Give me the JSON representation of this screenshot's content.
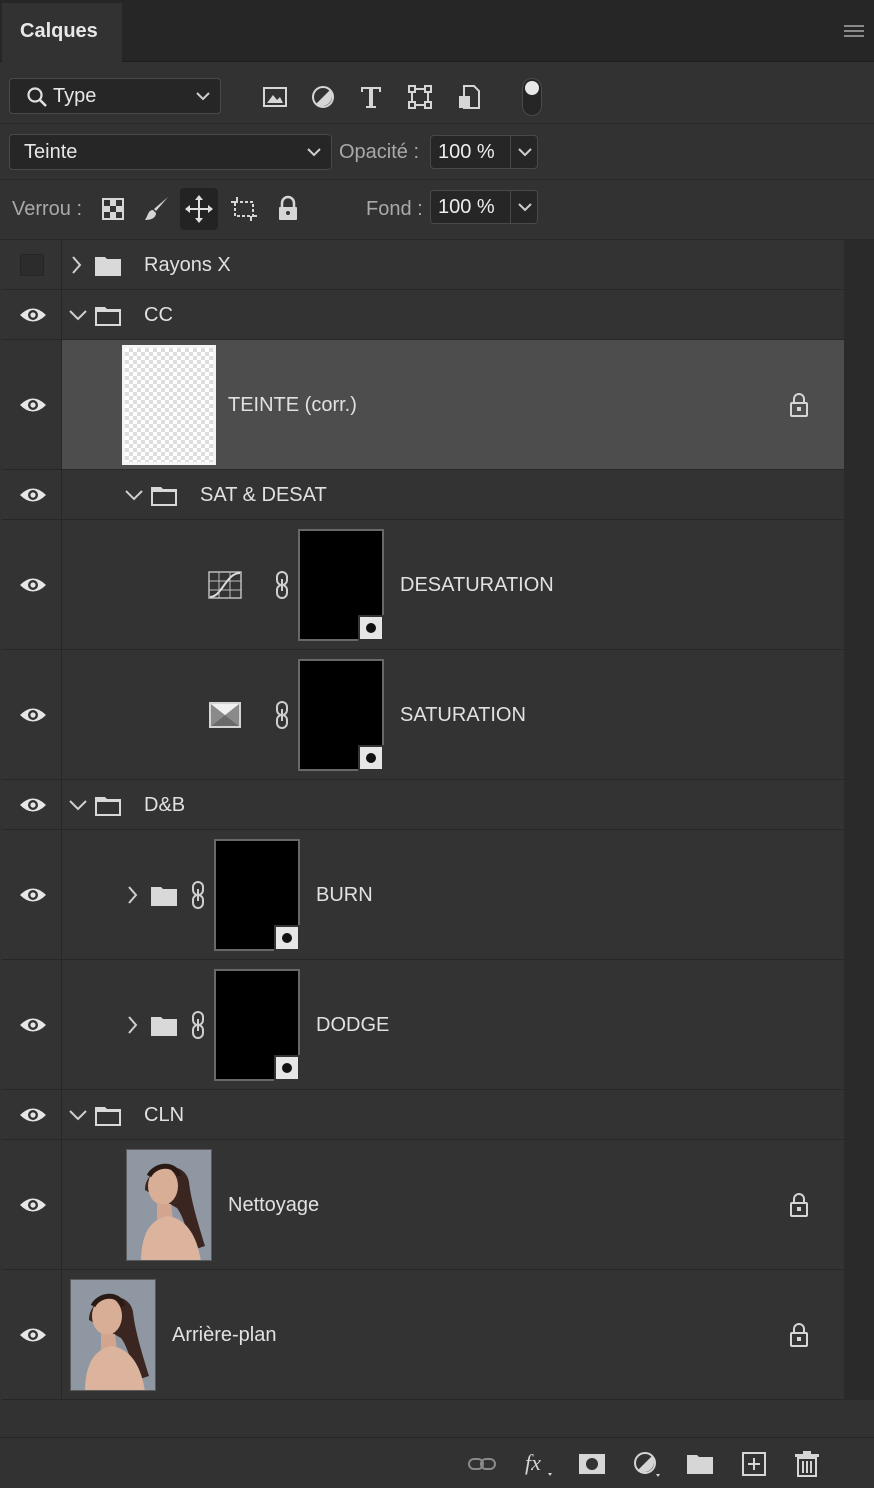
{
  "panel": {
    "title": "Calques"
  },
  "filter": {
    "selected": "Type",
    "icons": [
      "image-filter-icon",
      "adjustment-filter-icon",
      "type-filter-icon",
      "shape-filter-icon",
      "smart-object-filter-icon"
    ]
  },
  "blend": {
    "mode": "Teinte",
    "opacity_label": "Opacité :",
    "opacity_value": "100 %"
  },
  "lock": {
    "label": "Verrou :",
    "fill_label": "Fond :",
    "fill_value": "100 %"
  },
  "layers": [
    {
      "name": "Rayons X",
      "type": "group",
      "visible": false,
      "expanded": false
    },
    {
      "name": "CC",
      "type": "group",
      "visible": true,
      "expanded": true
    },
    {
      "name": "TEINTE (corr.)",
      "type": "pixel",
      "visible": true,
      "selected": true,
      "locked": true
    },
    {
      "name": "SAT & DESAT",
      "type": "group",
      "visible": true,
      "expanded": true
    },
    {
      "name": "DESATURATION",
      "type": "adjustment",
      "adjustment_icon": "curves-icon",
      "visible": true,
      "has_mask": true
    },
    {
      "name": "SATURATION",
      "type": "adjustment",
      "adjustment_icon": "hue-saturation-icon",
      "visible": true,
      "has_mask": true
    },
    {
      "name": "D&B",
      "type": "group",
      "visible": true,
      "expanded": true
    },
    {
      "name": "BURN",
      "type": "group",
      "visible": true,
      "expanded": false,
      "has_mask": true
    },
    {
      "name": "DODGE",
      "type": "group",
      "visible": true,
      "expanded": false,
      "has_mask": true
    },
    {
      "name": "CLN",
      "type": "group",
      "visible": true,
      "expanded": true
    },
    {
      "name": "Nettoyage",
      "type": "pixel",
      "visible": true,
      "locked": true
    },
    {
      "name": "Arrière-plan",
      "type": "background",
      "visible": true,
      "locked": true
    }
  ],
  "footer_icons": [
    "link-layers-icon",
    "fx-icon",
    "add-mask-icon",
    "new-adjustment-icon",
    "new-group-icon",
    "new-layer-icon",
    "delete-icon"
  ],
  "colors": {
    "panel_bg": "#323232",
    "selected_row": "#4d4d4d",
    "text": "#e1e1e1"
  }
}
